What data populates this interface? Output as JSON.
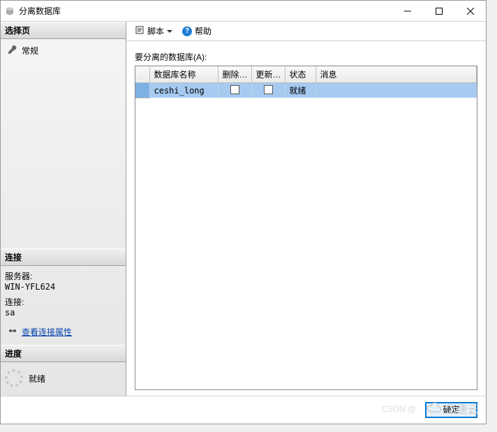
{
  "window": {
    "title": "分离数据库"
  },
  "sidebar": {
    "select_page_header": "选择页",
    "page_general": "常规",
    "connection_header": "连接",
    "server_label": "服务器:",
    "server_value": "WIN-YFL624",
    "conn_label": "连接:",
    "conn_value": "sa",
    "view_conn_props": "查看连接属性",
    "progress_header": "进度",
    "progress_status": "就绪"
  },
  "toolbar": {
    "script_label": "脚本",
    "help_label": "帮助"
  },
  "main": {
    "grid_label": "要分离的数据库(A):",
    "columns": {
      "name": "数据库名称",
      "drop": "删除…",
      "update": "更新…",
      "state": "状态",
      "message": "消息"
    },
    "rows": [
      {
        "name": "ceshi_long",
        "drop": false,
        "update": false,
        "state": "就绪",
        "message": ""
      }
    ]
  },
  "footer": {
    "ok": "确定"
  },
  "watermark": {
    "csdn": "CSDN @",
    "yisu": "亿速云"
  }
}
